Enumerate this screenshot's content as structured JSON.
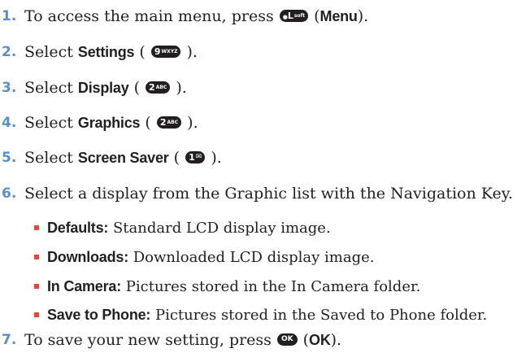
{
  "steps": [
    {
      "num": "1.",
      "pre": "To access the main menu, press ",
      "key": "L.soft",
      "key_label": "L",
      "key_sub": "soft",
      "post_open": " (",
      "bold": "Menu",
      "post_close": ")."
    },
    {
      "num": "2.",
      "pre": "Select ",
      "bold": "Settings",
      "mid_open": " ( ",
      "key_label": "9",
      "key_sub": "WXYZ",
      "post": " )."
    },
    {
      "num": "3.",
      "pre": "Select ",
      "bold": "Display",
      "mid_open": " ( ",
      "key_label": "2",
      "key_sub": "ABC",
      "post": " )."
    },
    {
      "num": "4.",
      "pre": "Select ",
      "bold": "Graphics",
      "mid_open": " ( ",
      "key_label": "2",
      "key_sub": "ABC",
      "post": " )."
    },
    {
      "num": "5.",
      "pre": "Select ",
      "bold": "Screen Saver",
      "mid_open": " ( ",
      "key_label": "1",
      "key_sub": "✉",
      "post": " )."
    },
    {
      "num": "6.",
      "text": "Select a display from the Graphic list with the Navigation Key."
    },
    {
      "num": "7.",
      "pre": "To save your new setting, press ",
      "key_label": "OK",
      "post_open": " (",
      "bold": "OK",
      "post_close": ")."
    }
  ],
  "options": [
    {
      "label": "Defaults:",
      "desc": " Standard LCD display image."
    },
    {
      "label": "Downloads:",
      "desc": " Downloaded LCD display image."
    },
    {
      "label": "In Camera:",
      "desc": " Pictures stored in the In Camera folder."
    },
    {
      "label": "Save to Phone:",
      "desc": " Pictures stored in the Saved to Phone folder."
    }
  ],
  "colors": {
    "step_number": "#5b8fc4",
    "bullet": "#e8463a",
    "text": "#231f20"
  }
}
